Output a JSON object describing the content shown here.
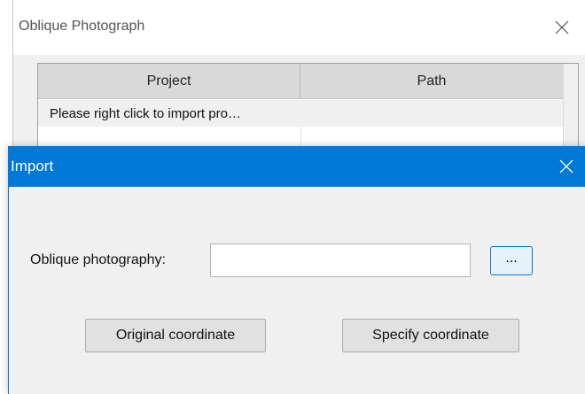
{
  "back_window": {
    "title": "Oblique Photograph",
    "close_icon": "close-icon",
    "table": {
      "columns": [
        "Project",
        "Path"
      ],
      "rows": [
        [
          "Please right click to import pro…",
          ""
        ]
      ]
    }
  },
  "import_dialog": {
    "title": "Import",
    "close_icon": "close-icon",
    "field_label": "Oblique photography:",
    "path_value": "",
    "browse_label": "...",
    "original_button": "Original coordinate",
    "specify_button": "Specify coordinate"
  },
  "colors": {
    "titlebar_accent": "#0078d7",
    "dialog_bg": "#f0f0f0",
    "header_bg": "#d9d9d9"
  }
}
